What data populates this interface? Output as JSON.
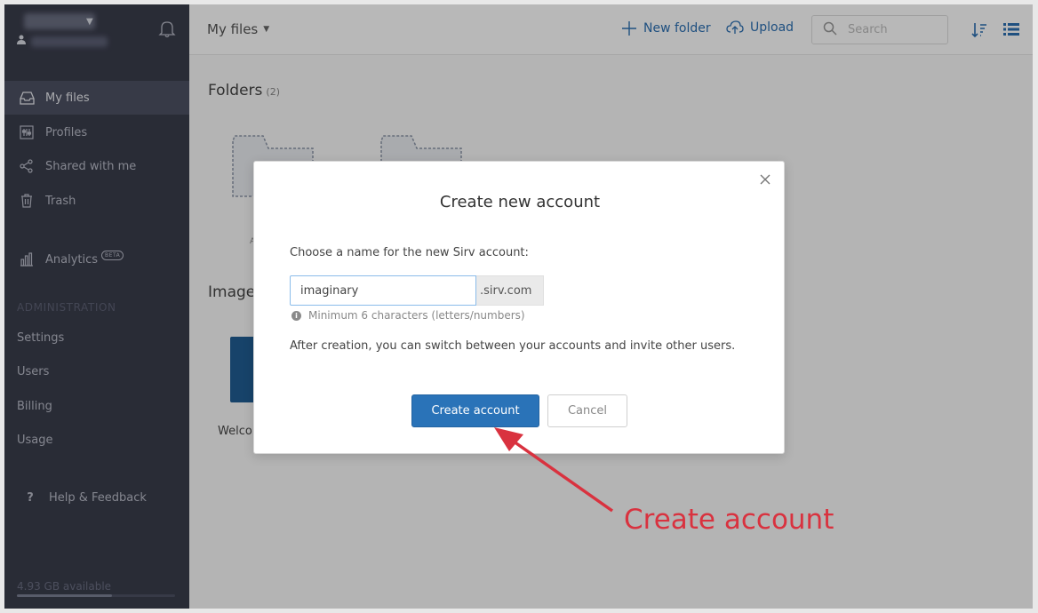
{
  "sidebar": {
    "nav": [
      {
        "label": "My files",
        "icon": "inbox-icon",
        "active": true
      },
      {
        "label": "Profiles",
        "icon": "profiles-icon"
      },
      {
        "label": "Shared with me",
        "icon": "share-icon"
      },
      {
        "label": "Trash",
        "icon": "trash-icon"
      },
      {
        "label": "Analytics",
        "icon": "bar-chart-icon",
        "badge": "BETA"
      }
    ],
    "admin_heading": "ADMINISTRATION",
    "admin_items": [
      "Settings",
      "Users",
      "Billing",
      "Usage"
    ],
    "help_label": "Help & Feedback",
    "storage_label": "4.93 GB available",
    "storage_used_fraction": 0.6
  },
  "topbar": {
    "title": "My files",
    "new_folder": "New folder",
    "upload": "Upload",
    "search_placeholder": "Search"
  },
  "content": {
    "folders_heading": "Folders",
    "folders_count": "(2)",
    "folder_caption_partial": "Au",
    "images_heading_partial": "Image",
    "image_caption_partial": "Welco"
  },
  "modal": {
    "title": "Create new account",
    "label": "Choose a name for the new Sirv account:",
    "input_value": "imaginary",
    "suffix": ".sirv.com",
    "hint": "Minimum 6 characters (letters/numbers)",
    "note": "After creation, you can switch between your accounts and invite other users.",
    "primary_button": "Create account",
    "secondary_button": "Cancel"
  },
  "annotation": {
    "text": "Create account",
    "color": "#d9323f"
  },
  "colors": {
    "sidebar": "#3a3d4c",
    "accent": "#2a73b8"
  }
}
